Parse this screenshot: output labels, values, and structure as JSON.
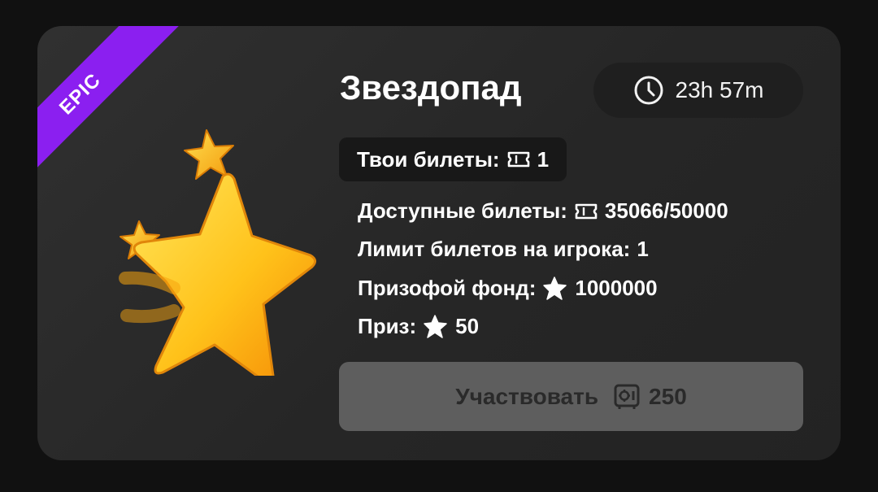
{
  "card": {
    "rarity_badge": "EPIC",
    "title": "Звездопад",
    "timer": {
      "icon": "clock-icon",
      "value": "23h 57m"
    },
    "my_tickets": {
      "label": "Твои билеты:",
      "icon": "ticket-icon",
      "value": "1"
    },
    "info": {
      "available_label": "Доступные билеты:",
      "available_value": "35066/50000",
      "limit_label": "Лимит билетов на игрока:",
      "limit_value": "1",
      "prize_pool_label": "Призофой фонд:",
      "prize_pool_value": "1000000",
      "prize_label": "Приз:",
      "prize_value": "50"
    },
    "participate_button": {
      "label": "Участвовать",
      "icon": "safe-icon",
      "price": "250"
    }
  },
  "colors": {
    "badge": "#8b1ff0",
    "card_bg": "#2a2a2a",
    "button_bg": "#5e5e5e",
    "star": "#ffc61a"
  }
}
